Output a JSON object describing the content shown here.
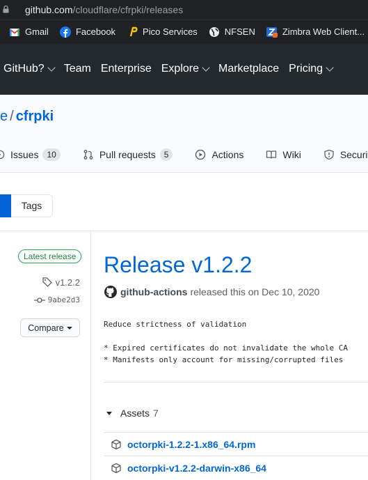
{
  "browser": {
    "url_host": "github.com",
    "url_path": "/cloudflare/cfrpki/releases",
    "bookmarks": [
      {
        "label": "Gmail",
        "icon": "gmail-icon",
        "color": "#ea4335"
      },
      {
        "label": "Facebook",
        "icon": "facebook-icon",
        "color": "#1877f2"
      },
      {
        "label": "Pico Services",
        "icon": "pico-icon",
        "color": "#f6c700"
      },
      {
        "label": "NFSEN",
        "icon": "globe-icon",
        "color": "#e8eaed"
      },
      {
        "label": "Zimbra Web Client...",
        "icon": "zimbra-icon",
        "color": "#1e6bd6"
      }
    ]
  },
  "header": {
    "nav": [
      {
        "label": "GitHub?",
        "caret": true
      },
      {
        "label": "Team",
        "caret": false
      },
      {
        "label": "Enterprise",
        "caret": false
      },
      {
        "label": "Explore",
        "caret": true
      },
      {
        "label": "Marketplace",
        "caret": false
      },
      {
        "label": "Pricing",
        "caret": true
      }
    ]
  },
  "repo": {
    "owner_fragment": "e",
    "separator": "/",
    "name": "cfrpki",
    "tabs": {
      "issues": {
        "label": "Issues",
        "count": "10"
      },
      "pulls": {
        "label": "Pull requests",
        "count": "5"
      },
      "actions": {
        "label": "Actions"
      },
      "wiki": {
        "label": "Wiki"
      },
      "security": {
        "label": "Security"
      }
    }
  },
  "subnav": {
    "tags_label": "Tags"
  },
  "release": {
    "latest_badge": "Latest release",
    "tag": "v1.2.2",
    "commit": "9abe2d3",
    "compare_label": "Compare",
    "title": "Release v1.2.2",
    "author": "github-actions",
    "released_text": "released this on Dec 10, 2020",
    "notes": [
      "Reduce strictness of validation",
      "",
      "* Expired certificates do not invalidate the whole CA",
      "* Manifests only account for missing/corrupted files"
    ],
    "assets_label": "Assets",
    "assets_count": "7",
    "assets": [
      "octorpki-1.2.2-1.x86_64.rpm",
      "octorpki-v1.2.2-darwin-x86_64"
    ]
  }
}
